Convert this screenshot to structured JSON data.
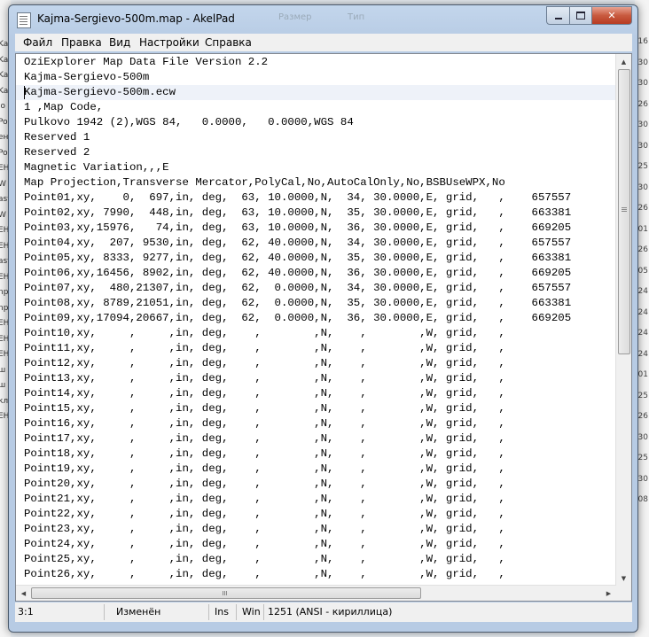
{
  "window": {
    "title": "Kajma-Sergievo-500m.map - AkelPad"
  },
  "background": {
    "title_ghost": [
      "Размер",
      "Тип"
    ],
    "left_fragments": [
      "Kaj",
      "Kaj",
      "Kaj",
      "Kaj",
      "lo",
      "Po",
      "ен",
      "Po",
      "ЕН",
      "W",
      "ast",
      "W",
      "ЕН",
      "ЕН",
      "ast",
      "ЕН",
      "npl",
      "npl",
      "ЕН",
      "ЕН",
      "ЕН",
      "ш",
      "ш",
      "кл",
      "ЕН"
    ],
    "right_fragments": [
      "16",
      "30",
      "30",
      "26",
      "30",
      "30",
      "25",
      "30",
      "26",
      "01",
      "26",
      "05",
      "24",
      "24",
      "24",
      "24",
      "01",
      "25",
      "26",
      "30",
      "25",
      "30",
      "08"
    ]
  },
  "menu": [
    "Файл",
    "Правка",
    "Вид",
    "Настройки",
    "Справка"
  ],
  "lines": [
    "OziExplorer Map Data File Version 2.2",
    "Kajma-Sergievo-500m",
    "Kajma-Sergievo-500m.ecw",
    "1 ,Map Code,",
    "Pulkovo 1942 (2),WGS 84,   0.0000,   0.0000,WGS 84",
    "Reserved 1",
    "Reserved 2",
    "Magnetic Variation,,,E",
    "Map Projection,Transverse Mercator,PolyCal,No,AutoCalOnly,No,BSBUseWPX,No",
    "Point01,xy,    0,  697,in, deg,  63, 10.0000,N,  34, 30.0000,E, grid,   ,    657557",
    "Point02,xy, 7990,  448,in, deg,  63, 10.0000,N,  35, 30.0000,E, grid,   ,    663381",
    "Point03,xy,15976,   74,in, deg,  63, 10.0000,N,  36, 30.0000,E, grid,   ,    669205",
    "Point04,xy,  207, 9530,in, deg,  62, 40.0000,N,  34, 30.0000,E, grid,   ,    657557",
    "Point05,xy, 8333, 9277,in, deg,  62, 40.0000,N,  35, 30.0000,E, grid,   ,    663381",
    "Point06,xy,16456, 8902,in, deg,  62, 40.0000,N,  36, 30.0000,E, grid,   ,    669205",
    "Point07,xy,  480,21307,in, deg,  62,  0.0000,N,  34, 30.0000,E, grid,   ,    657557",
    "Point08,xy, 8789,21051,in, deg,  62,  0.0000,N,  35, 30.0000,E, grid,   ,    663381",
    "Point09,xy,17094,20667,in, deg,  62,  0.0000,N,  36, 30.0000,E, grid,   ,    669205",
    "Point10,xy,     ,     ,in, deg,    ,        ,N,    ,        ,W, grid,   ,",
    "Point11,xy,     ,     ,in, deg,    ,        ,N,    ,        ,W, grid,   ,",
    "Point12,xy,     ,     ,in, deg,    ,        ,N,    ,        ,W, grid,   ,",
    "Point13,xy,     ,     ,in, deg,    ,        ,N,    ,        ,W, grid,   ,",
    "Point14,xy,     ,     ,in, deg,    ,        ,N,    ,        ,W, grid,   ,",
    "Point15,xy,     ,     ,in, deg,    ,        ,N,    ,        ,W, grid,   ,",
    "Point16,xy,     ,     ,in, deg,    ,        ,N,    ,        ,W, grid,   ,",
    "Point17,xy,     ,     ,in, deg,    ,        ,N,    ,        ,W, grid,   ,",
    "Point18,xy,     ,     ,in, deg,    ,        ,N,    ,        ,W, grid,   ,",
    "Point19,xy,     ,     ,in, deg,    ,        ,N,    ,        ,W, grid,   ,",
    "Point20,xy,     ,     ,in, deg,    ,        ,N,    ,        ,W, grid,   ,",
    "Point21,xy,     ,     ,in, deg,    ,        ,N,    ,        ,W, grid,   ,",
    "Point22,xy,     ,     ,in, deg,    ,        ,N,    ,        ,W, grid,   ,",
    "Point23,xy,     ,     ,in, deg,    ,        ,N,    ,        ,W, grid,   ,",
    "Point24,xy,     ,     ,in, deg,    ,        ,N,    ,        ,W, grid,   ,",
    "Point25,xy,     ,     ,in, deg,    ,        ,N,    ,        ,W, grid,   ,",
    "Point26,xy,     ,     ,in, deg,    ,        ,N,    ,        ,W, grid,   ,"
  ],
  "status": {
    "position": "3:1",
    "modified": "Изменён",
    "insert_mode": "Ins",
    "newline": "Win",
    "codepage": "1251  (ANSI - кириллица)"
  },
  "icons": [
    "app-icon",
    "minimize-icon",
    "maximize-icon",
    "close-icon",
    "scroll-up-icon",
    "scroll-down-icon",
    "scroll-left-icon",
    "scroll-right-icon"
  ],
  "colors": {
    "close_button": "#c85a3f",
    "current_line": "#eef2f9"
  }
}
